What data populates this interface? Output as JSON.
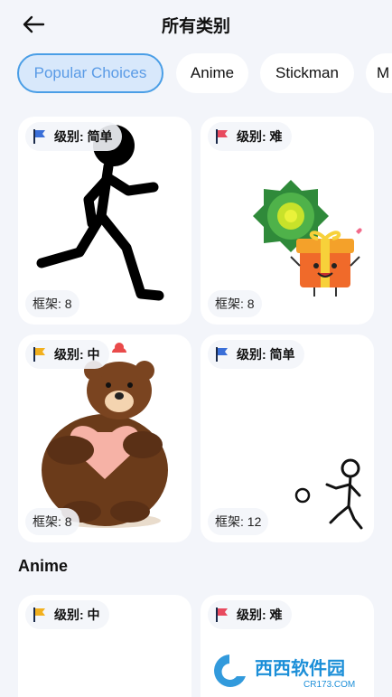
{
  "header": {
    "title": "所有类别"
  },
  "chips": [
    {
      "label": "Popular Choices",
      "active": true
    },
    {
      "label": "Anime",
      "active": false
    },
    {
      "label": "Stickman",
      "active": false
    },
    {
      "label": "M",
      "active": false
    }
  ],
  "popular": {
    "cards": [
      {
        "level": "级别: 简单",
        "flag_color": "#3a6fd8",
        "frames": "框架: 8"
      },
      {
        "level": "级别: 难",
        "flag_color": "#e84a5f",
        "frames": "框架: 8"
      },
      {
        "level": "级别: 中",
        "flag_color": "#f2b01e",
        "frames": "框架: 8"
      },
      {
        "level": "级别: 简单",
        "flag_color": "#3a6fd8",
        "frames": "框架: 12"
      }
    ]
  },
  "anime": {
    "title": "Anime",
    "cards": [
      {
        "level": "级别: 中",
        "flag_color": "#f2b01e"
      },
      {
        "level": "级别: 难",
        "flag_color": "#e84a5f"
      }
    ]
  },
  "watermark": {
    "brand": "西西软件园",
    "site": "CR173.COM"
  }
}
